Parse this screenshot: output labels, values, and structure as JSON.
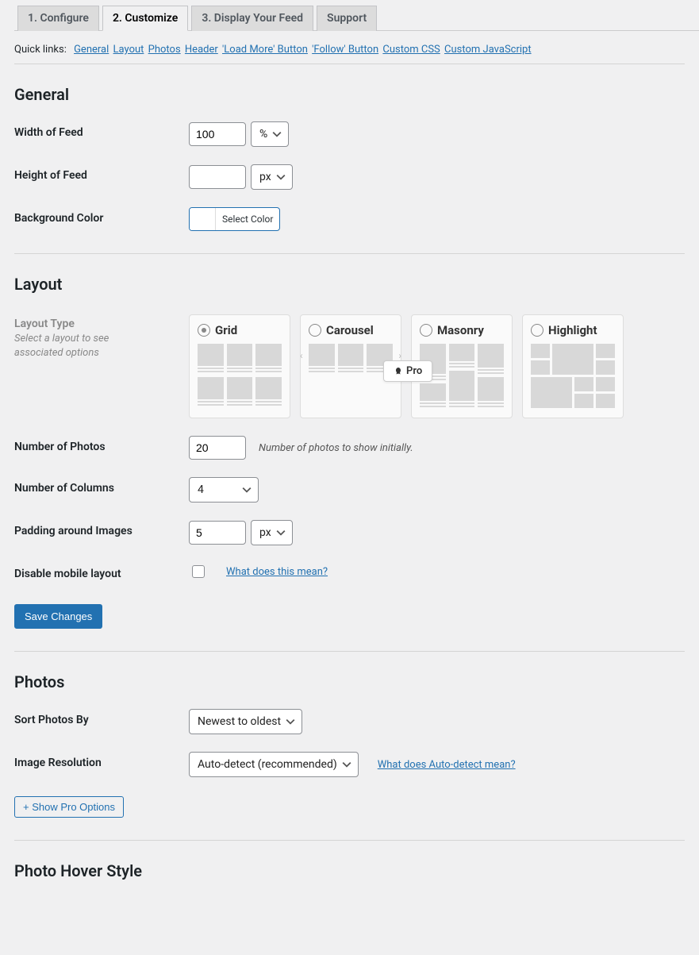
{
  "tabs": [
    "1. Configure",
    "2. Customize",
    "3. Display Your Feed",
    "Support"
  ],
  "active_tab_index": 1,
  "quick_links": {
    "lead": "Quick links:",
    "items": [
      "General",
      "Layout",
      "Photos",
      "Header",
      "'Load More' Button",
      "'Follow' Button",
      "Custom CSS",
      "Custom JavaScript"
    ]
  },
  "sections": {
    "general": {
      "title": "General",
      "width": {
        "label": "Width of Feed",
        "value": "100",
        "unit": "%"
      },
      "height": {
        "label": "Height of Feed",
        "value": "",
        "unit": "px"
      },
      "bg": {
        "label": "Background Color",
        "button": "Select Color"
      }
    },
    "layout": {
      "title": "Layout",
      "type": {
        "label": "Layout Type",
        "desc": "Select a layout to see associated options"
      },
      "options": [
        "Grid",
        "Carousel",
        "Masonry",
        "Highlight"
      ],
      "selected_index": 0,
      "pro_badge": "Pro",
      "num_photos": {
        "label": "Number of Photos",
        "value": "20",
        "hint": "Number of photos to show initially."
      },
      "num_cols": {
        "label": "Number of Columns",
        "value": "4"
      },
      "padding": {
        "label": "Padding around Images",
        "value": "5",
        "unit": "px"
      },
      "disable_mobile": {
        "label": "Disable mobile layout",
        "checked": false,
        "help": "What does this mean?"
      },
      "save_btn": "Save Changes"
    },
    "photos": {
      "title": "Photos",
      "sort": {
        "label": "Sort Photos By",
        "value": "Newest to oldest"
      },
      "res": {
        "label": "Image Resolution",
        "value": "Auto-detect (recommended)",
        "help": "What does Auto-detect mean?"
      },
      "show_pro_btn": "+ Show Pro Options"
    },
    "hover": {
      "title": "Photo Hover Style"
    }
  }
}
